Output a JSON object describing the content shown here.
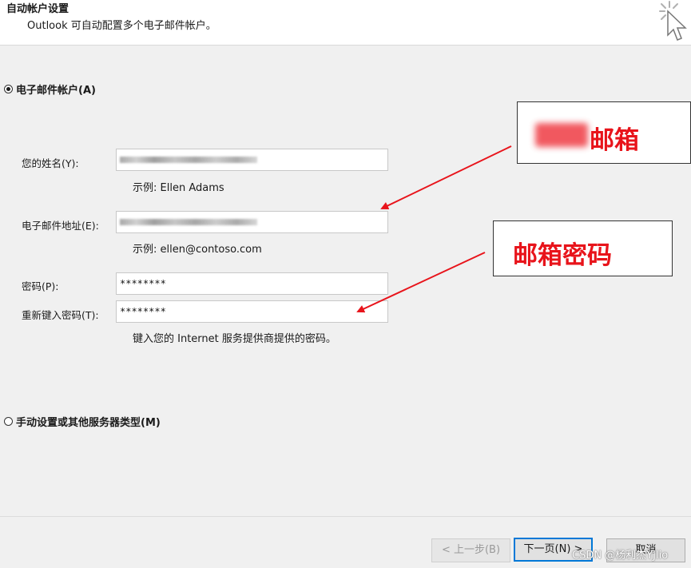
{
  "header": {
    "title": "自动帐户设置",
    "subtitle": "Outlook 可自动配置多个电子邮件帐户。"
  },
  "options": {
    "email_account_label": "电子邮件帐户(A)",
    "email_account_selected": true,
    "manual_label": "手动设置或其他服务器类型(M)",
    "manual_selected": false
  },
  "form": {
    "name_label": "您的姓名(Y):",
    "name_value": "",
    "name_example": "示例: Ellen Adams",
    "email_label": "电子邮件地址(E):",
    "email_value": "",
    "email_example": "示例: ellen@contoso.com",
    "password_label": "密码(P):",
    "password_value": "********",
    "retype_label": "重新键入密码(T):",
    "retype_value": "********",
    "password_hint": "键入您的 Internet 服务提供商提供的密码。"
  },
  "buttons": {
    "back": "< 上一步(B)",
    "next": "下一页(N) >",
    "cancel": "取消"
  },
  "annotations": {
    "email_note": "邮箱",
    "password_note": "邮箱密码",
    "color": "#e8141b"
  },
  "watermark": "CSDN @杨利杰YJlio"
}
